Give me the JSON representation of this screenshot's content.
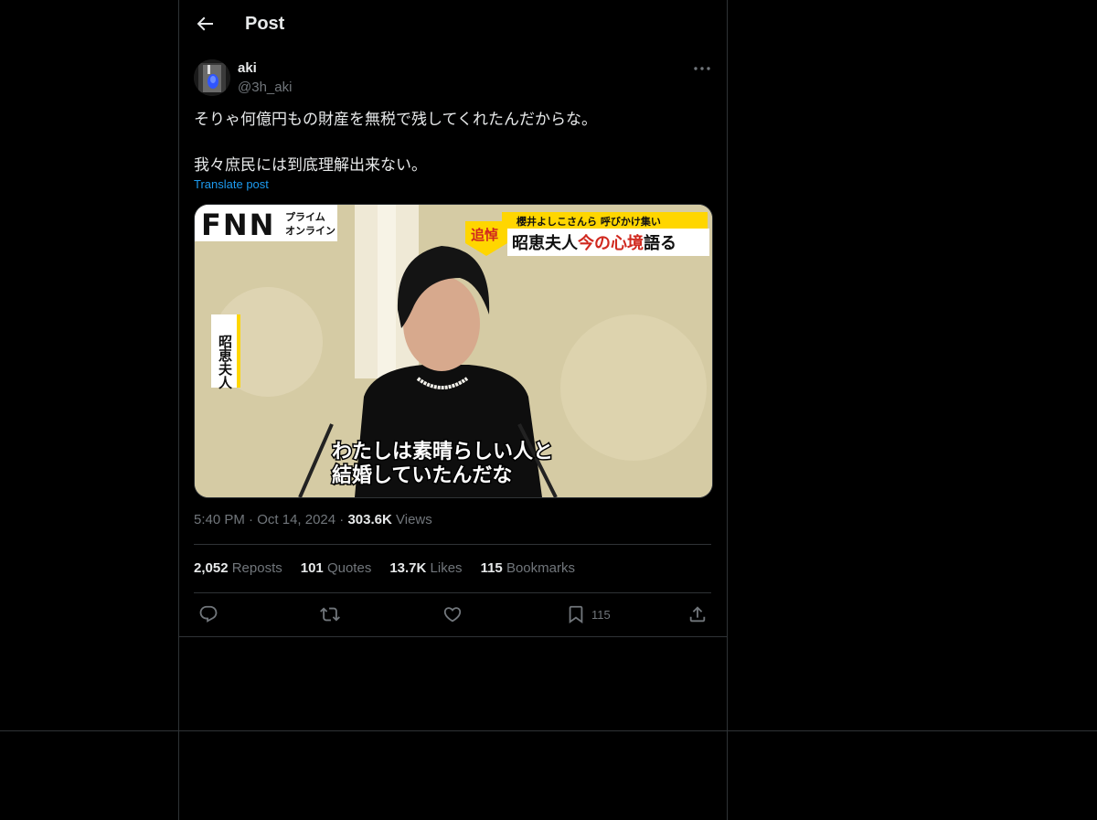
{
  "header": {
    "title": "Post"
  },
  "author": {
    "name": "aki",
    "handle": "@3h_aki"
  },
  "post": {
    "line1": "そりゃ何億円もの財産を無税で残してくれたんだからな。",
    "line2": "我々庶民には到底理解出来ない。",
    "translate_label": "Translate post"
  },
  "media": {
    "logo_letters": "FNN",
    "logo_sub1": "プライム",
    "logo_sub2": "オンライン",
    "badge": "追悼",
    "banner_top": "櫻井よしこさんら 呼びかけ集い",
    "banner_main_a": "昭恵夫人",
    "banner_main_b": "今の心境",
    "banner_main_c": "語る",
    "side_label": "昭恵夫人",
    "subtitle_1": "わたしは素晴らしい人と",
    "subtitle_2": "結婚していたんだな"
  },
  "meta": {
    "time": "5:40 PM",
    "date": "Oct 14, 2024",
    "views": "303.6K",
    "views_label": "Views",
    "dot": "·"
  },
  "stats": [
    {
      "value": "2,052",
      "label": "Reposts"
    },
    {
      "value": "101",
      "label": "Quotes"
    },
    {
      "value": "13.7K",
      "label": "Likes"
    },
    {
      "value": "115",
      "label": "Bookmarks"
    }
  ],
  "actions": {
    "bookmark_count": "115"
  },
  "colors": {
    "accent": "#1d9bf0",
    "muted": "#71767b",
    "border": "#2f3336",
    "banner_red": "#d0281e"
  }
}
